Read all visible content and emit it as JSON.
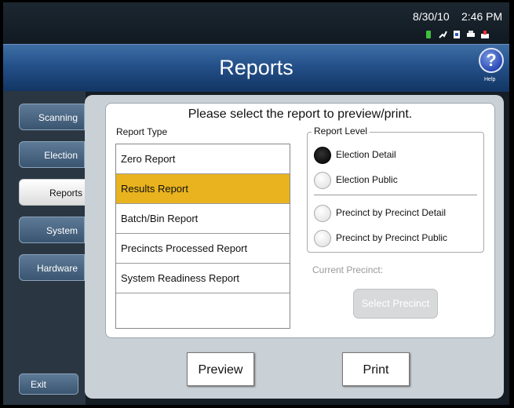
{
  "status": {
    "date": "8/30/10",
    "time": "2:46 PM"
  },
  "header": {
    "title": "Reports",
    "help_label": "Help",
    "help_symbol": "?"
  },
  "nav": {
    "items": [
      {
        "label": "Scanning"
      },
      {
        "label": "Election"
      },
      {
        "label": "Reports"
      },
      {
        "label": "System"
      },
      {
        "label": "Hardware"
      }
    ],
    "exit_label": "Exit"
  },
  "main": {
    "prompt": "Please select the report to preview/print.",
    "report_type_label": "Report Type",
    "report_types": [
      {
        "label": "Zero Report"
      },
      {
        "label": "Results Report"
      },
      {
        "label": "Batch/Bin Report"
      },
      {
        "label": "Precincts Processed Report"
      },
      {
        "label": "System Readiness Report"
      }
    ],
    "report_level_label": "Report Level",
    "levels": [
      {
        "label": "Election Detail"
      },
      {
        "label": "Election Public"
      },
      {
        "label": "Precinct by Precinct Detail"
      },
      {
        "label": "Precinct by Precinct Public"
      }
    ],
    "current_precinct_label": "Current Precinct:",
    "select_precinct_label": "Select Precinct",
    "preview_label": "Preview",
    "print_label": "Print"
  }
}
